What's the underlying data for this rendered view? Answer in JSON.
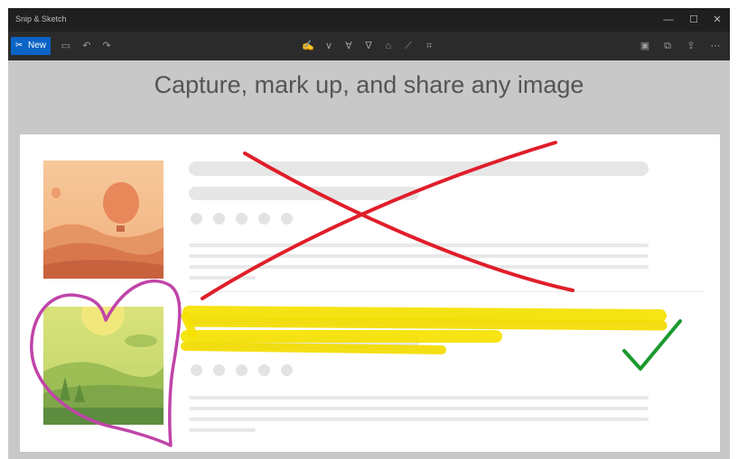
{
  "window": {
    "title": "Snip & Sketch",
    "minimize_glyph": "—",
    "maximize_glyph": "☐",
    "close_glyph": "✕"
  },
  "toolbar": {
    "new_label": "New",
    "new_icon": "snip-icon"
  },
  "canvas": {
    "headline": "Capture, mark up, and share any image"
  },
  "colors": {
    "accent": "#0a63c6",
    "ink_red": "#e01e2a",
    "ink_green": "#1a9a2e",
    "ink_magenta": "#c044a8",
    "highlighter_yellow": "#f5e200"
  }
}
